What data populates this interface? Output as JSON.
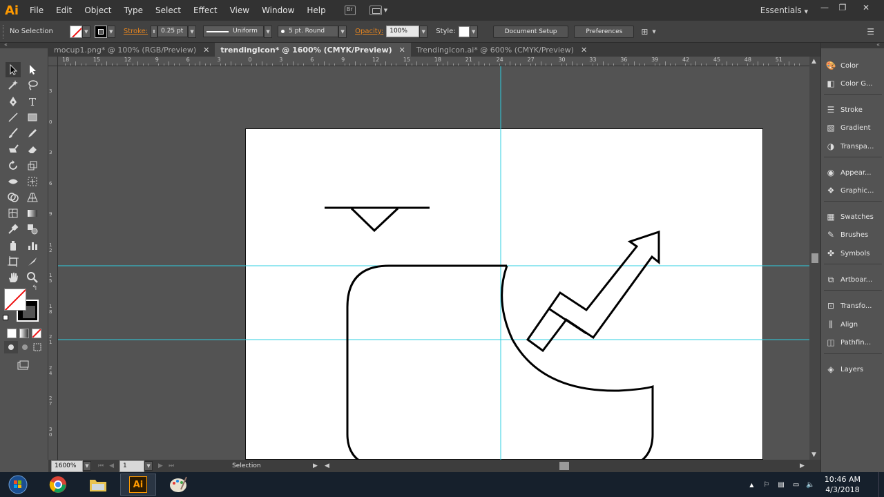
{
  "app": {
    "logo": "Ai"
  },
  "menu": [
    "File",
    "Edit",
    "Object",
    "Type",
    "Select",
    "Effect",
    "View",
    "Window",
    "Help"
  ],
  "workspace": {
    "label": "Essentials"
  },
  "window_controls": {
    "minimize": "—",
    "restore": "❐",
    "close": "✕"
  },
  "control_bar": {
    "selection_status": "No Selection",
    "stroke_label": "Stroke:",
    "stroke_weight": "0.25 pt",
    "profile": "Uniform",
    "brush": "5 pt. Round",
    "opacity_label": "Opacity:",
    "opacity": "100%",
    "style_label": "Style:",
    "document_setup": "Document Setup",
    "preferences": "Preferences"
  },
  "tabs": [
    {
      "label": "mocup1.png* @ 100% (RGB/Preview)",
      "active": false
    },
    {
      "label": "trendingIcon* @ 1600% (CMYK/Preview)",
      "active": true
    },
    {
      "label": "TrendingIcon.ai* @ 600% (CMYK/Preview)",
      "active": false
    }
  ],
  "ruler_top": [
    "18",
    "15",
    "12",
    "9",
    "6",
    "3",
    "0",
    "3",
    "6",
    "9",
    "12",
    "15",
    "18",
    "21",
    "24",
    "27",
    "30",
    "33",
    "36",
    "39",
    "42",
    "45",
    "48",
    "51"
  ],
  "ruler_left": [
    "3",
    "0",
    "3",
    "6",
    "9",
    "1\n2",
    "1\n5",
    "1\n8",
    "2\n1",
    "2\n4",
    "2\n7",
    "3\n0"
  ],
  "status_bar": {
    "zoom": "1600%",
    "artboard_num": "1",
    "tool": "Selection"
  },
  "panels": [
    {
      "label": "Color",
      "icon": "color-palette-icon"
    },
    {
      "label": "Color G...",
      "icon": "color-guide-icon"
    },
    {
      "label": "Stroke",
      "icon": "stroke-lines-icon"
    },
    {
      "label": "Gradient",
      "icon": "gradient-icon"
    },
    {
      "label": "Transpa...",
      "icon": "transparency-icon"
    },
    {
      "label": "Appear...",
      "icon": "appearance-icon"
    },
    {
      "label": "Graphic...",
      "icon": "graphic-styles-icon"
    },
    {
      "label": "Swatches",
      "icon": "swatches-icon"
    },
    {
      "label": "Brushes",
      "icon": "brushes-icon"
    },
    {
      "label": "Symbols",
      "icon": "symbols-icon"
    },
    {
      "label": "Artboar...",
      "icon": "artboards-icon"
    },
    {
      "label": "Transfo...",
      "icon": "transform-icon"
    },
    {
      "label": "Align",
      "icon": "align-icon"
    },
    {
      "label": "Pathfin...",
      "icon": "pathfinder-icon"
    },
    {
      "label": "Layers",
      "icon": "layers-icon"
    }
  ],
  "taskbar": {
    "apps": [
      "Start",
      "Chrome",
      "File Explorer",
      "Illustrator",
      "Paint"
    ],
    "time": "10:46 AM",
    "date": "4/3/2018"
  },
  "colors": {
    "guide": "#2ecfe0",
    "accent": "#ff9a00",
    "stroke_label": "#e6851f"
  }
}
